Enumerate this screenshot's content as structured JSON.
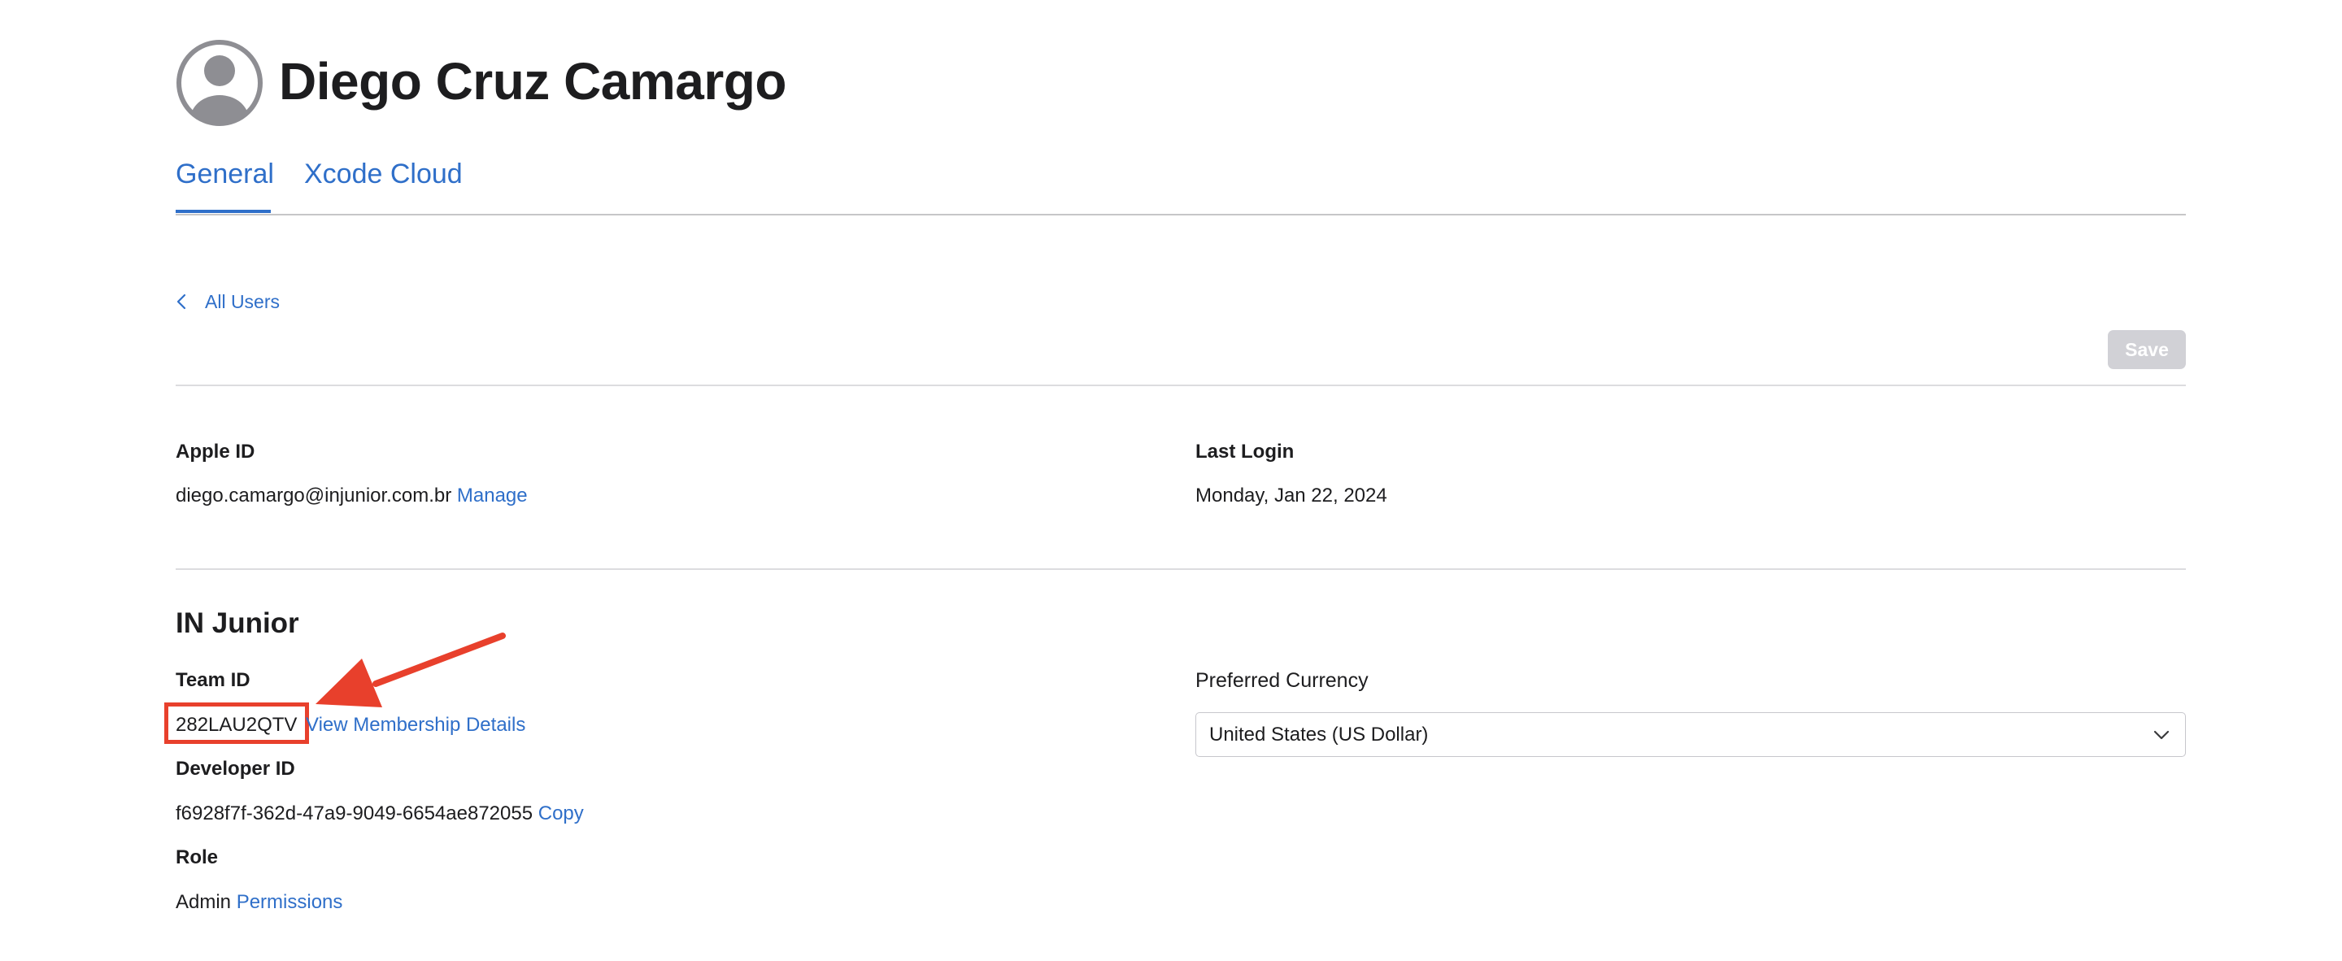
{
  "user": {
    "name": "Diego Cruz Camargo"
  },
  "icons": {
    "avatar": "person-circle-icon",
    "back": "chevron-left-icon",
    "dropdown": "chevron-down-icon",
    "annotation": "arrow-icon"
  },
  "colors": {
    "accent": "#2f6fc9",
    "annotation": "#e8402c"
  },
  "tabs": [
    {
      "label": "General",
      "active": true
    },
    {
      "label": "Xcode Cloud",
      "active": false
    }
  ],
  "back_link": {
    "label": "All Users"
  },
  "toolbar": {
    "save_label": "Save",
    "save_enabled": false
  },
  "account": {
    "apple_id_label": "Apple ID",
    "apple_id_value": "diego.camargo@injunior.com.br",
    "manage_label": "Manage",
    "last_login_label": "Last Login",
    "last_login_value": "Monday, Jan 22, 2024"
  },
  "team": {
    "name": "IN Junior",
    "team_id_label": "Team ID",
    "team_id_value": "282LAU2QTV",
    "membership_link": "View Membership Details",
    "developer_id_label": "Developer ID",
    "developer_id_value": "f6928f7f-362d-47a9-9049-6654ae872055",
    "copy_label": "Copy",
    "role_label": "Role",
    "role_value": "Admin",
    "permissions_label": "Permissions",
    "currency_label": "Preferred Currency",
    "currency_value": "United States (US Dollar)"
  }
}
